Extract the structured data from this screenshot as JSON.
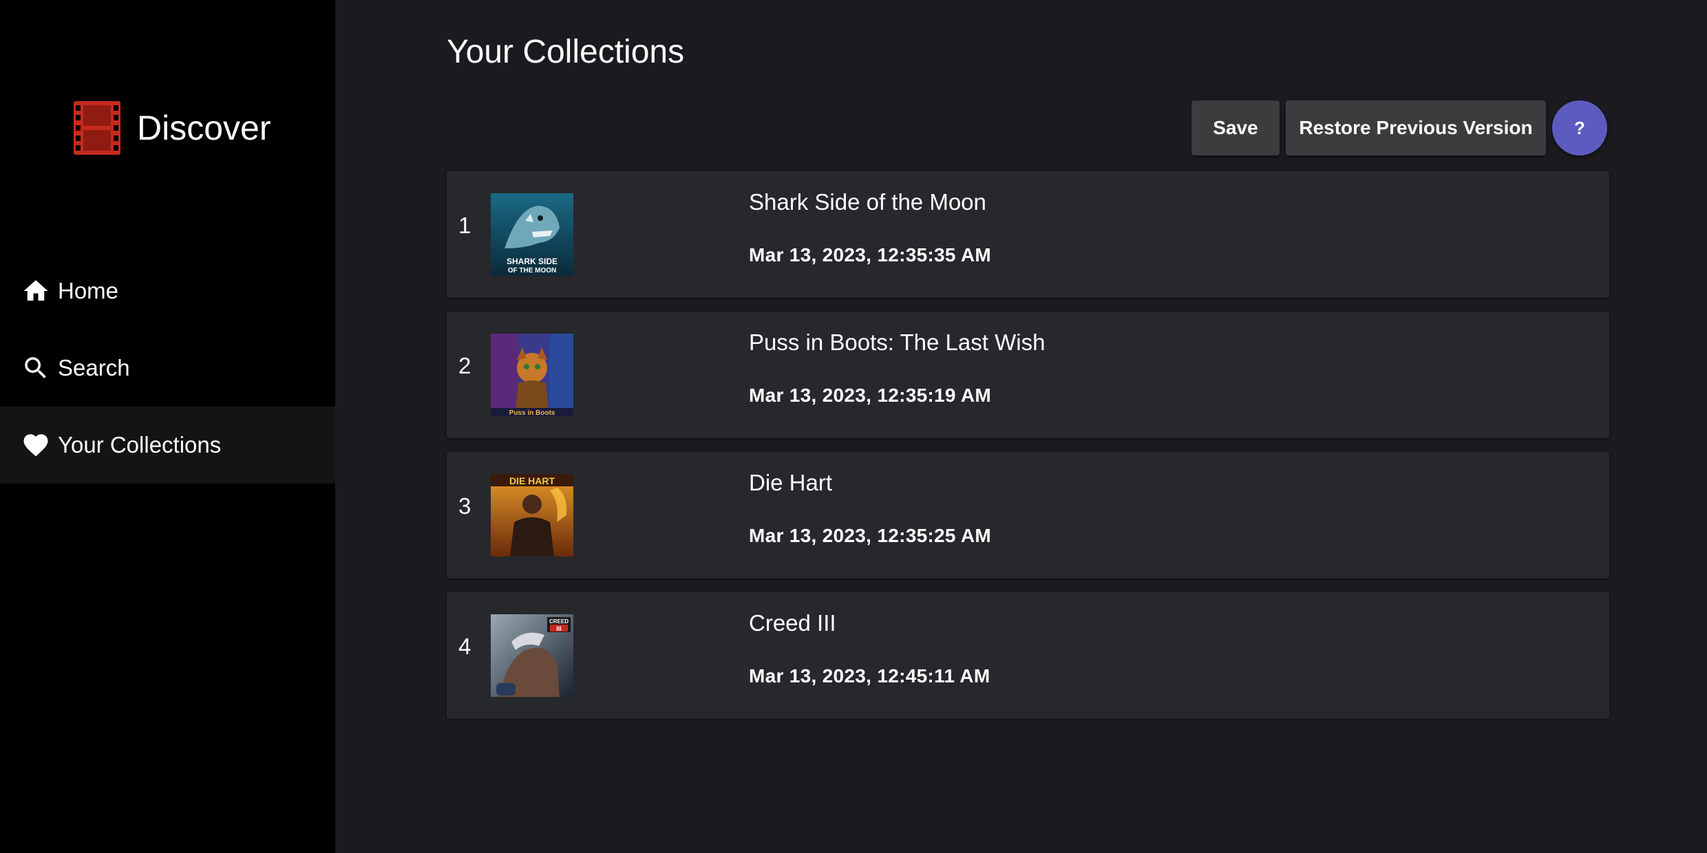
{
  "brand": {
    "name": "Discover",
    "logo_icon": "film-strip-icon",
    "logo_color": "#c62a1e"
  },
  "sidebar": {
    "items": [
      {
        "label": "Home",
        "icon": "home-icon",
        "active": false
      },
      {
        "label": "Search",
        "icon": "search-icon",
        "active": false
      },
      {
        "label": "Your Collections",
        "icon": "heart-icon",
        "active": true
      }
    ]
  },
  "main": {
    "title": "Your Collections",
    "toolbar": {
      "save_label": "Save",
      "restore_label": "Restore Previous Version",
      "help_label": "?"
    },
    "collections": [
      {
        "index": "1",
        "title": "Shark Side of the Moon",
        "date": "Mar 13, 2023, 12:35:35 AM",
        "poster_text": "SHARK SIDE OF THE MOON"
      },
      {
        "index": "2",
        "title": "Puss in Boots: The Last Wish",
        "date": "Mar 13, 2023, 12:35:19 AM",
        "poster_text": "Puss in Boots"
      },
      {
        "index": "3",
        "title": "Die Hart",
        "date": "Mar 13, 2023, 12:35:25 AM",
        "poster_text": "DIE HART"
      },
      {
        "index": "4",
        "title": "Creed III",
        "date": "Mar 13, 2023, 12:45:11 AM",
        "poster_text": "CREED III"
      }
    ]
  },
  "colors": {
    "sidebar_bg": "#000000",
    "main_bg": "#1b1b1f",
    "row_bg": "#27282c",
    "button_bg": "#3c3c3e",
    "help_button_bg": "#5c5cc0"
  }
}
